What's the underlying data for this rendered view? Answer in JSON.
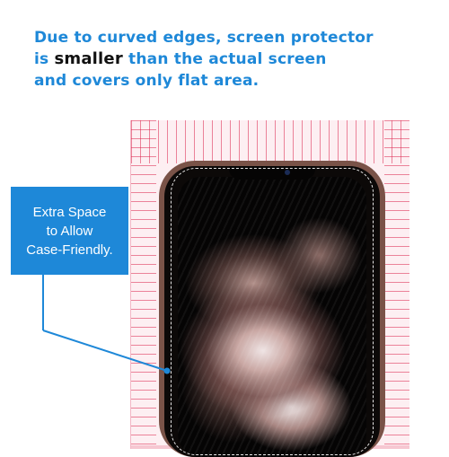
{
  "headline": {
    "line1": "Due to curved edges, screen protector",
    "line2_prefix": "is ",
    "line2_emphasis": "smaller",
    "line2_suffix": " than the actual screen",
    "line3": "and covers only flat area."
  },
  "callout": {
    "lines": [
      "Extra Space",
      "to Allow",
      "Case-Friendly."
    ]
  },
  "colors": {
    "accent": "#1e88d8",
    "ruler_tint": "#fdeff2",
    "ruler_ticks": "#dc2850",
    "phone_frame": "#7a5348"
  },
  "icons": {
    "camera": "front-camera-dot"
  }
}
